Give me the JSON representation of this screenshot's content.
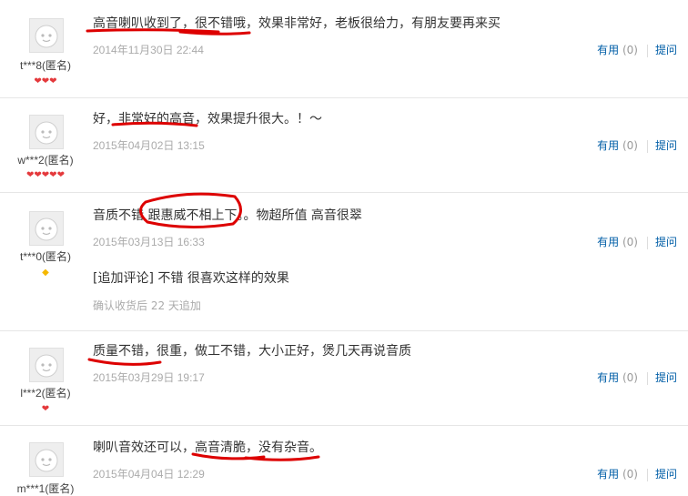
{
  "reviews": [
    {
      "user": "t***8(匿名)",
      "level": "❤❤❤",
      "content": "高音喇叭收到了，很不错哦，效果非常好，老板很给力，有朋友要再来买",
      "date": "2014年11月30日 22:44"
    },
    {
      "user": "w***2(匿名)",
      "level": "❤❤❤❤❤",
      "content": "好，非常好的高音，效果提升很大。！～",
      "date": "2015年04月02日 13:15"
    },
    {
      "user": "t***0(匿名)",
      "level": "◆",
      "content": "音质不错 跟惠威不相上下。。物超所值 高音很翠",
      "date": "2015年03月13日 16:33",
      "followup": "[追加评论] 不错 很喜欢这样的效果",
      "followup_note": "确认收货后 22 天追加"
    },
    {
      "user": "l***2(匿名)",
      "level": "❤",
      "content": "质量不错，很重，做工不错，大小正好，煲几天再说音质",
      "date": "2015年03月29日 19:17"
    },
    {
      "user": "m***1(匿名)",
      "level": "",
      "content": "喇叭音效还可以，高音清脆，没有杂音。",
      "date": "2015年04月04日 12:29"
    }
  ],
  "actions": {
    "useful_label": "有用",
    "useful_count": "(0)",
    "reply_label": "提问"
  },
  "colors": {
    "link": "#005ea7",
    "date": "#aaaaaa",
    "mark": "#dd0000"
  }
}
